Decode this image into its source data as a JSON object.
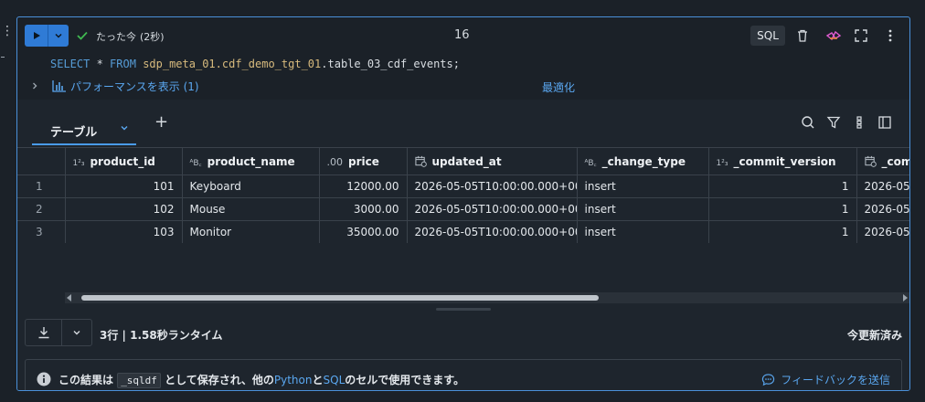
{
  "toolbar": {
    "status_text": "たった今",
    "status_duration": "(2秒)",
    "cell_number": "16",
    "language": "SQL"
  },
  "code": {
    "keyword_select": "SELECT",
    "star": " * ",
    "keyword_from": "FROM",
    "table_ref": "sdp_meta_01.cdf_demo_tgt_01",
    "table_suffix": ".table_03_cdf_events;"
  },
  "performance": {
    "label": "パフォーマンスを表示 (1)",
    "optimize": "最適化"
  },
  "results": {
    "tab_label": "テーブル",
    "add_tab": "+",
    "columns": [
      {
        "type": "1²₃",
        "name": "product_id"
      },
      {
        "type": "A^B_C",
        "name": "product_name"
      },
      {
        "type": ".00",
        "name": "price"
      },
      {
        "type": "calendar-clock-icon",
        "name": "updated_at"
      },
      {
        "type": "A^B_C",
        "name": "_change_type"
      },
      {
        "type": "1²₃",
        "name": "_commit_version"
      },
      {
        "type": "calendar-clock-icon",
        "name": "_com"
      }
    ],
    "rows": [
      {
        "n": "1",
        "product_id": "101",
        "product_name": "Keyboard",
        "price": "12000.00",
        "updated_at": "2026-05-05T10:00:00.000+00:...",
        "change_type": "insert",
        "commit_version": "1",
        "commit_ts": "2026-05-"
      },
      {
        "n": "2",
        "product_id": "102",
        "product_name": "Mouse",
        "price": "3000.00",
        "updated_at": "2026-05-05T10:00:00.000+00:...",
        "change_type": "insert",
        "commit_version": "1",
        "commit_ts": "2026-05-"
      },
      {
        "n": "3",
        "product_id": "103",
        "product_name": "Monitor",
        "price": "35000.00",
        "updated_at": "2026-05-05T10:00:00.000+00:...",
        "change_type": "insert",
        "commit_version": "1",
        "commit_ts": "2026-05-"
      }
    ],
    "summary": "3行 | 1.58秒ランタイム",
    "refreshed": "今更新済み"
  },
  "info": {
    "msg_prefix": "この結果は ",
    "msg_var": "_sqldf",
    "msg_mid": " として保存され、他の",
    "msg_python": "Python",
    "msg_and": "と",
    "msg_sql": "SQL",
    "msg_suffix": "のセルで使用できます。",
    "feedback": "フィードバックを送信"
  },
  "colors": {
    "accent": "#2f7bd6",
    "link": "#5aa7f0",
    "success": "#3fb950"
  }
}
